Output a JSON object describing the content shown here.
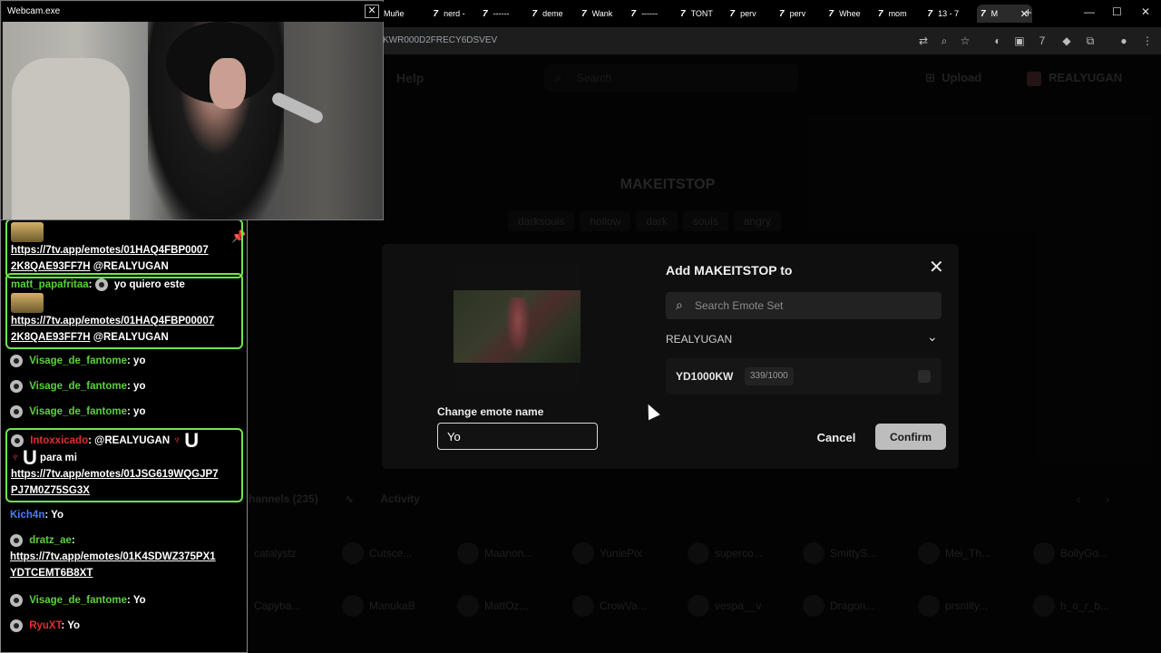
{
  "browser": {
    "tabs": [
      {
        "label": "Muñe",
        "active": false
      },
      {
        "label": "nerd -",
        "active": false
      },
      {
        "label": "------",
        "active": false
      },
      {
        "label": "deme",
        "active": false
      },
      {
        "label": "Wank",
        "active": false
      },
      {
        "label": "------",
        "active": false
      },
      {
        "label": "TONT",
        "active": false
      },
      {
        "label": "perv",
        "active": false
      },
      {
        "label": "perv",
        "active": false
      },
      {
        "label": "Whee",
        "active": false
      },
      {
        "label": "mom",
        "active": false
      },
      {
        "label": "13 - 7",
        "active": false
      },
      {
        "label": "M",
        "active": true
      }
    ],
    "tab_icon": "7",
    "new_tab": "+",
    "window_controls": [
      "—",
      "☐",
      "✕"
    ],
    "url": "KWR000D2FRECY6DSVEV"
  },
  "site": {
    "help": "Help",
    "search_placeholder": "Search",
    "upload": "Upload",
    "username": "REALYUGAN",
    "emote_title": "MAKEITSTOP",
    "tags": [
      "darksouls",
      "hollow",
      "dark",
      "souls",
      "angry"
    ],
    "channels_tab": "hannels (235)",
    "activity_tab": "Activity",
    "channels": [
      "catalystz",
      "Cutsce...",
      "Maanon...",
      "YuniePix",
      "superco...",
      "SmittyS...",
      "Mei_Th...",
      "BollyGo...",
      "Capyba...",
      "ManukaB",
      "MattOz...",
      "CrowVa...",
      "vespa__v",
      "Dragon...",
      "prsnlity...",
      "h_o_r_b..."
    ]
  },
  "modal": {
    "title": "Add MAKEITSTOP to",
    "close": "✕",
    "search_placeholder": "Search Emote Set",
    "owner": "REALYUGAN",
    "set_name": "YD1000KW",
    "set_count": "339/1000",
    "rename_label": "Change emote name",
    "rename_value": "Yo",
    "cancel": "Cancel",
    "confirm": "Confirm"
  },
  "webcam": {
    "title": "Webcam.exe",
    "close": "✕"
  },
  "chat": {
    "messages": [
      {
        "link": "https://7tv.app/emotes/01HAQ4FBP0007 2K8QAE93FF7H",
        "mention": "@REALYUGAN"
      },
      {
        "user": "matt_papafritaa",
        "text": "yo quiero este",
        "link": "https://7tv.app/emotes/01HAQ4FBP00007 2K8QAE93FF7H",
        "mention": "@REALYUGAN"
      },
      {
        "user": "Visage_de_fantome",
        "text": "yo"
      },
      {
        "user": "Visage_de_fantome",
        "text": "yo"
      },
      {
        "user": "Visage_de_fantome",
        "text": "yo"
      },
      {
        "user": "Intoxxicado",
        "mention": "@REALYUGAN",
        "text": "para mi",
        "link": "https://7tv.app/emotes/01JSG619WQGJP7 PJ7M0Z75SG3X"
      },
      {
        "user": "Kich4n",
        "text": "Yo"
      },
      {
        "user": "dratz_ae",
        "link": "https://7tv.app/emotes/01K4SDWZ375PX1 YDTCEMT6B8XT"
      },
      {
        "user": "Visage_de_fantome",
        "text": "Yo"
      },
      {
        "user": "RyuXT",
        "text": "Yo"
      }
    ]
  },
  "colors": {
    "chat_highlight": "#6ee84a",
    "user_green": "#5bd13c",
    "user_blue": "#4a7dff",
    "user_red": "#e0312c",
    "confirm_bg": "#bdbdbd"
  }
}
